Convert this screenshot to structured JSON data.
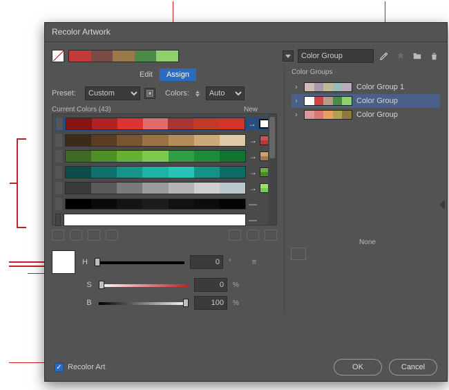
{
  "dialog": {
    "title": "Recolor Artwork"
  },
  "top": {
    "group_name": "Color Group"
  },
  "tabs": {
    "edit": "Edit",
    "assign": "Assign"
  },
  "preset": {
    "label": "Preset:",
    "value": "Custom",
    "colors_label": "Colors:",
    "colors_value": "Auto"
  },
  "current": {
    "label": "Current Colors (43)",
    "new_label": "New",
    "count": 43
  },
  "hsb": {
    "h_label": "H",
    "s_label": "S",
    "b_label": "B",
    "h": "0",
    "s": "0",
    "b": "100",
    "deg": "°",
    "pct": "%"
  },
  "none": {
    "label": "None"
  },
  "groups": {
    "heading": "Color Groups",
    "items": [
      "Color Group 1",
      "Color Group",
      "Color Group"
    ]
  },
  "footer": {
    "recolor": "Recolor Art",
    "ok": "OK",
    "cancel": "Cancel"
  }
}
